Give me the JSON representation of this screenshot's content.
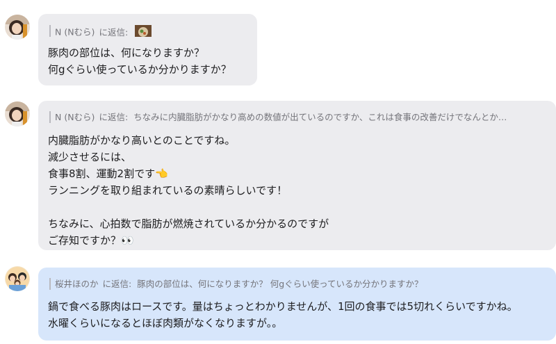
{
  "messages": [
    {
      "reply_to_name": "N (Nむら)",
      "reply_label": "に返信:",
      "reply_quote": "",
      "has_thumbnail": true,
      "lines": [
        "豚肉の部位は、何になりますか？",
        "何gぐらい使っているか分かりますか？"
      ]
    },
    {
      "reply_to_name": "N (Nむら)",
      "reply_label": "に返信:",
      "reply_quote": "ちなみに内臓脂肪がかなり高めの数値が出ているのですか、これは食事の改善だけでなんとか…",
      "lines": [
        "内臓脂肪がかなり高いとのことですね。",
        "減少させるには、",
        "食事8割、運動2割です👈",
        "ランニングを取り組まれているの素晴らしいです！",
        "",
        "ちなみに、心拍数で脂肪が燃焼されているか分かるのですが",
        "ご存知ですか？👀"
      ]
    },
    {
      "reply_to_name": "桜井ほのか",
      "reply_label": "に返信:",
      "reply_quote": "豚肉の部位は、何になりますか？ 何gぐらい使っているか分かりますか？",
      "lines": [
        "鍋で食べる豚肉はロースです。量はちょっとわかりませんが、1回の食事では5切れくらいですかね。",
        "水曜くらいになるとほぼ肉類がなくなりますが。。"
      ]
    }
  ],
  "colors": {
    "incoming_bubble": "#ececef",
    "outgoing_bubble": "#d7e6fb",
    "reply_text": "#74747a",
    "message_text": "#1c1c1e"
  },
  "icons": [
    "avatar-woman-icon",
    "avatar-family-icon",
    "food-thumbnail-icon"
  ]
}
